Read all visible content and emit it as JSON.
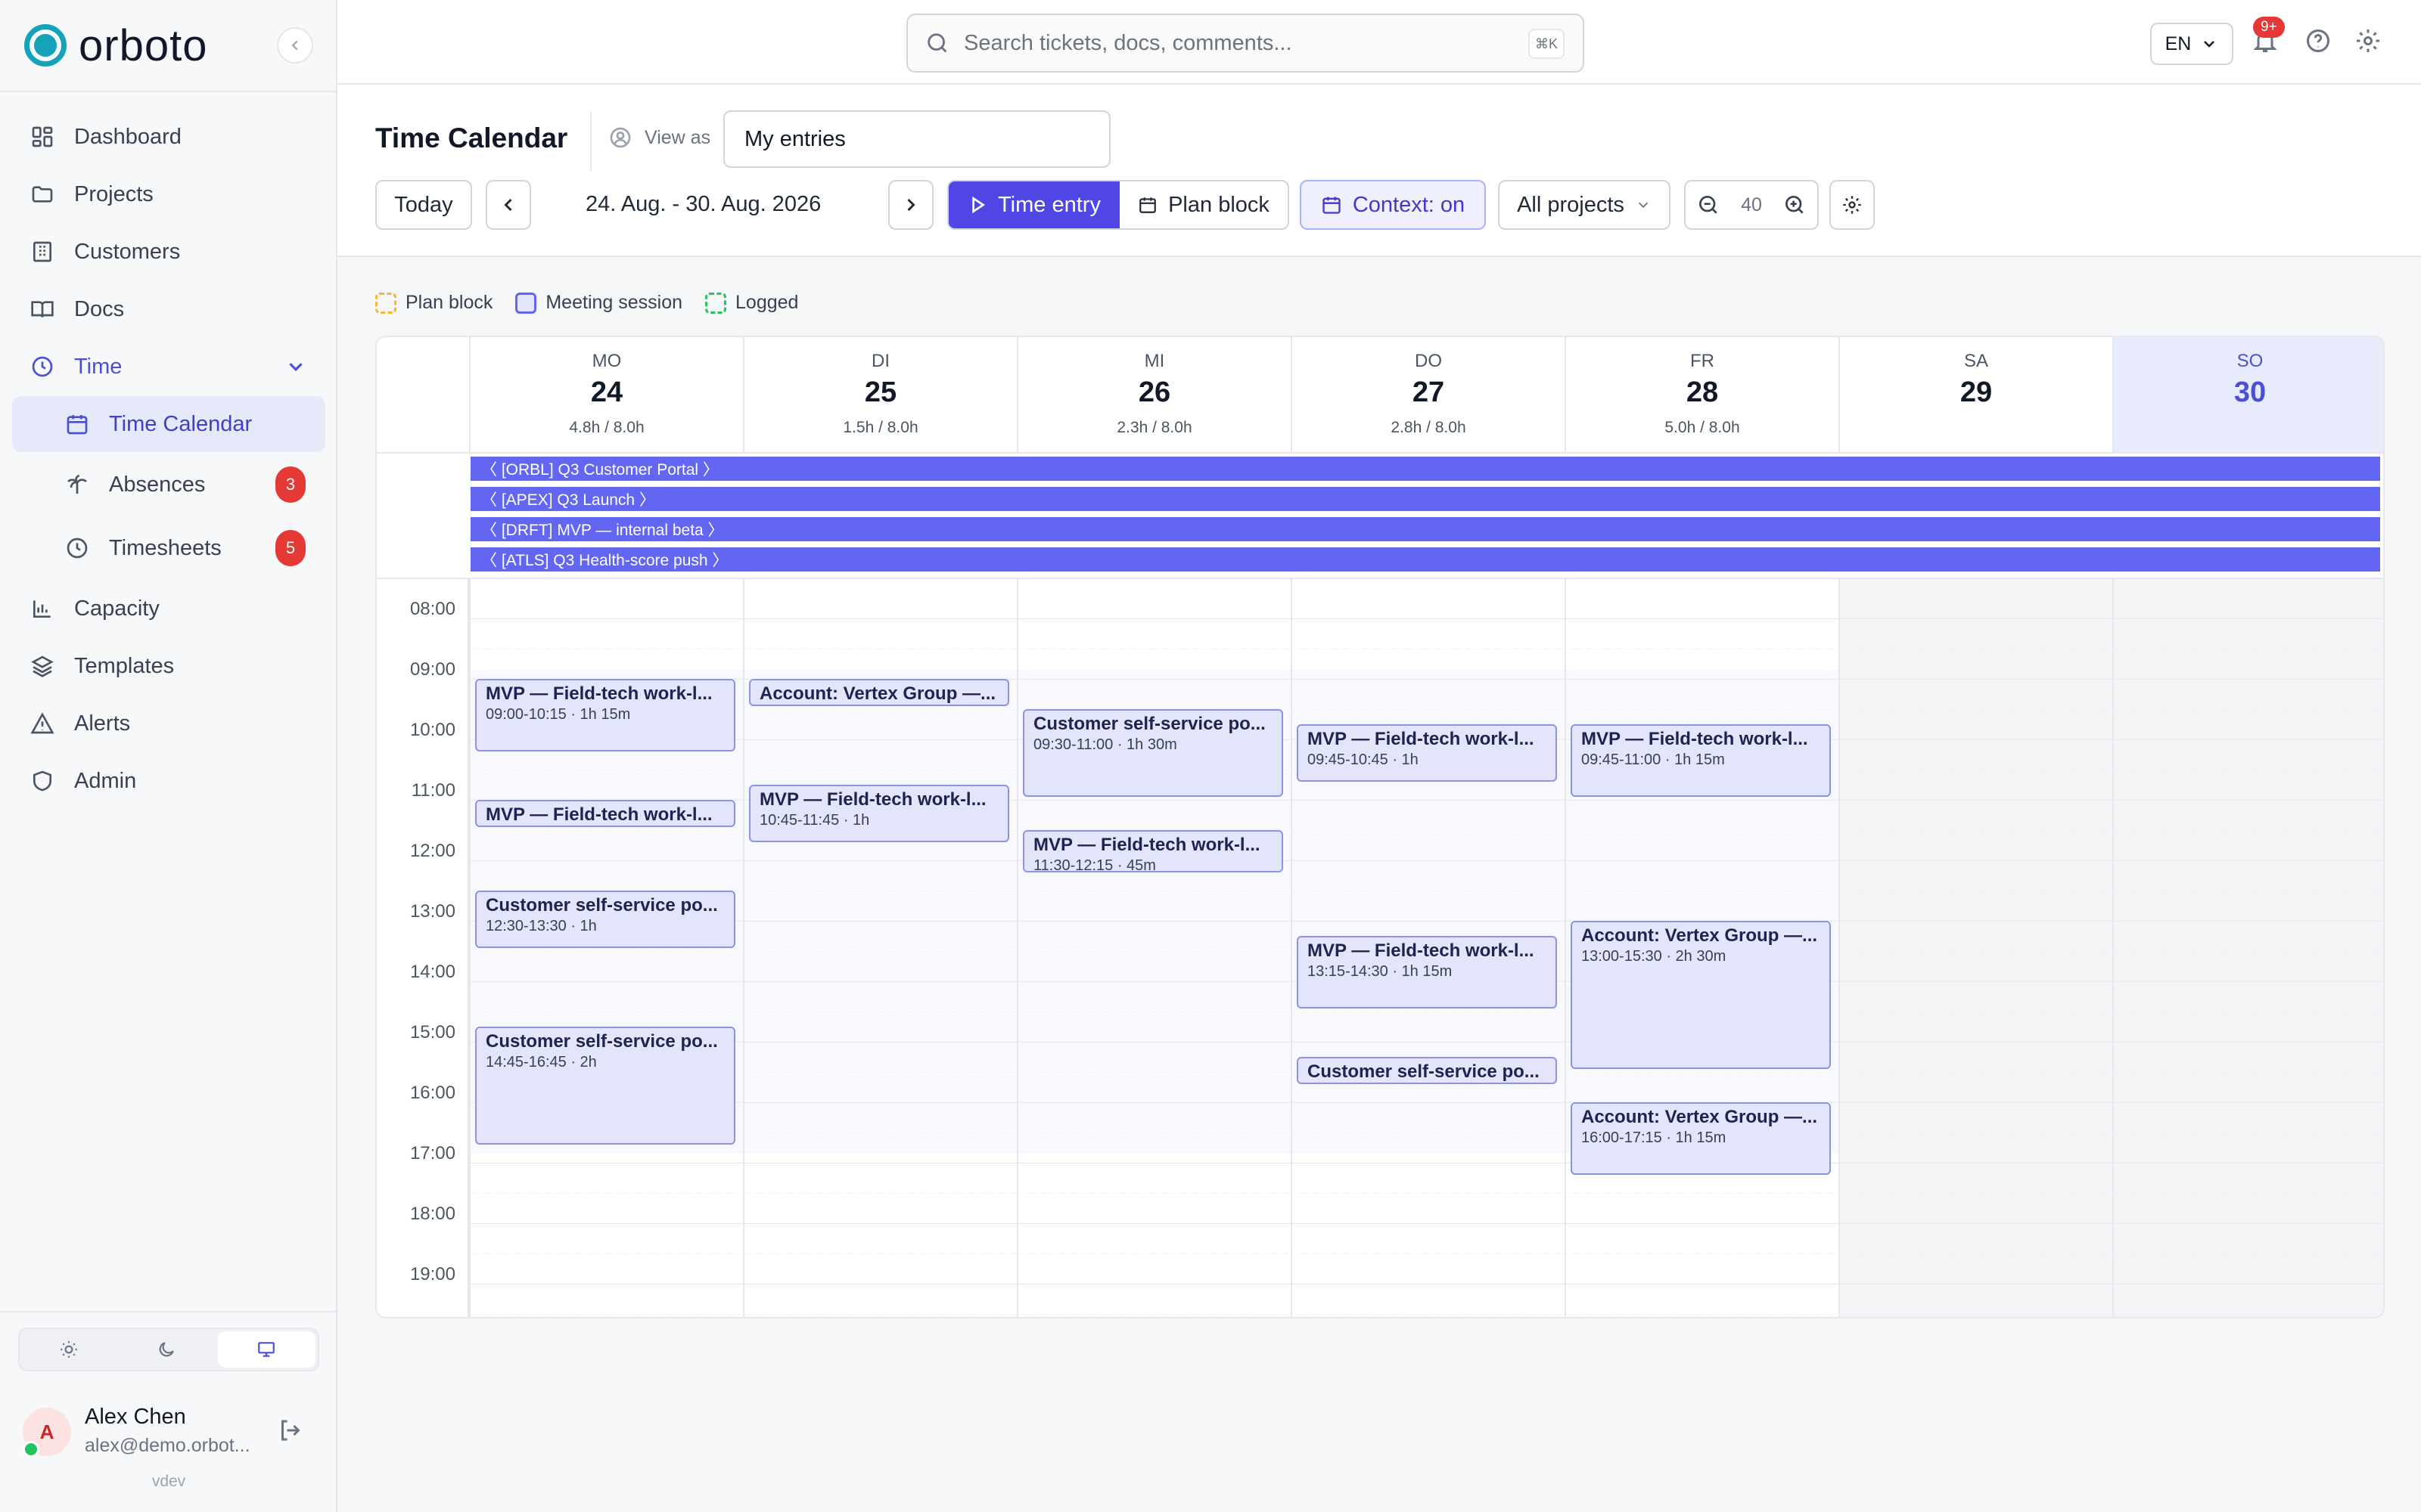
{
  "app": {
    "name": "orboto",
    "version": "vdev"
  },
  "sidebar": {
    "items": [
      {
        "label": "Dashboard",
        "icon": "dashboard-icon"
      },
      {
        "label": "Projects",
        "icon": "folder-icon"
      },
      {
        "label": "Customers",
        "icon": "building-icon"
      },
      {
        "label": "Docs",
        "icon": "book-icon"
      },
      {
        "label": "Time",
        "icon": "clock-icon"
      },
      {
        "label": "Time Calendar",
        "icon": "calendar-icon"
      },
      {
        "label": "Absences",
        "icon": "palm-tree-icon",
        "badge": "3"
      },
      {
        "label": "Timesheets",
        "icon": "clock-icon",
        "badge": "5"
      },
      {
        "label": "Capacity",
        "icon": "bar-chart-icon"
      },
      {
        "label": "Templates",
        "icon": "layers-icon"
      },
      {
        "label": "Alerts",
        "icon": "alert-triangle-icon"
      },
      {
        "label": "Admin",
        "icon": "shield-icon"
      }
    ],
    "theme": [
      "light",
      "dark",
      "system"
    ]
  },
  "user": {
    "initial": "A",
    "name": "Alex Chen",
    "email": "alex@demo.orbot..."
  },
  "topbar": {
    "search_placeholder": "Search tickets, docs, comments...",
    "shortcut": "⌘K",
    "language": "EN",
    "notifications_badge": "9+"
  },
  "header": {
    "title": "Time Calendar",
    "view_as_label": "View as",
    "view_as_value": "My entries",
    "today_label": "Today",
    "date_range": "24. Aug. - 30. Aug. 2026",
    "time_entry_label": "Time entry",
    "plan_block_label": "Plan block",
    "context_label": "Context: on",
    "projects_filter": "All projects",
    "zoom_value": "40"
  },
  "legend": [
    {
      "label": "Plan block",
      "color": "#f5b82e"
    },
    {
      "label": "Meeting session",
      "color": "#6366f1"
    },
    {
      "label": "Logged",
      "color": "#22c55e"
    }
  ],
  "calendar": {
    "days": [
      {
        "name": "MO",
        "num": "24",
        "hours": "4.8h / 8.0h"
      },
      {
        "name": "DI",
        "num": "25",
        "hours": "1.5h / 8.0h"
      },
      {
        "name": "MI",
        "num": "26",
        "hours": "2.3h / 8.0h"
      },
      {
        "name": "DO",
        "num": "27",
        "hours": "2.8h / 8.0h"
      },
      {
        "name": "FR",
        "num": "28",
        "hours": "5.0h / 8.0h"
      },
      {
        "name": "SA",
        "num": "29",
        "hours": ""
      },
      {
        "name": "SO",
        "num": "30",
        "hours": ""
      }
    ],
    "allday": [
      "〈 [ORBL] Q3 Customer Portal 〉",
      "〈 [APEX] Q3 Launch 〉",
      "〈 [DRFT] MVP — internal beta 〉",
      "〈 [ATLS] Q3 Health-score push 〉"
    ],
    "hours": [
      "08:00",
      "09:00",
      "10:00",
      "11:00",
      "12:00",
      "13:00",
      "14:00",
      "15:00",
      "16:00",
      "17:00",
      "18:00",
      "19:00"
    ],
    "events": [
      {
        "day": 0,
        "start": "09:00",
        "end": "10:15",
        "title": "MVP — Field-tech work-l...",
        "sub": "09:00-10:15 · 1h 15m"
      },
      {
        "day": 0,
        "start": "11:00",
        "end": "11:30",
        "title": "MVP — Field-tech work-l...",
        "sub": ""
      },
      {
        "day": 0,
        "start": "12:30",
        "end": "13:30",
        "title": "Customer self-service po...",
        "sub": "12:30-13:30 · 1h"
      },
      {
        "day": 0,
        "start": "14:45",
        "end": "16:45",
        "title": "Customer self-service po...",
        "sub": "14:45-16:45 · 2h"
      },
      {
        "day": 1,
        "start": "09:00",
        "end": "09:30",
        "title": "Account: Vertex Group —...",
        "sub": ""
      },
      {
        "day": 1,
        "start": "10:45",
        "end": "11:45",
        "title": "MVP — Field-tech work-l...",
        "sub": "10:45-11:45 · 1h"
      },
      {
        "day": 2,
        "start": "09:30",
        "end": "11:00",
        "title": "Customer self-service po...",
        "sub": "09:30-11:00 · 1h 30m"
      },
      {
        "day": 2,
        "start": "11:30",
        "end": "12:15",
        "title": "MVP — Field-tech work-l...",
        "sub": "11:30-12:15 · 45m"
      },
      {
        "day": 3,
        "start": "09:45",
        "end": "10:45",
        "title": "MVP — Field-tech work-l...",
        "sub": "09:45-10:45 · 1h"
      },
      {
        "day": 3,
        "start": "13:15",
        "end": "14:30",
        "title": "MVP — Field-tech work-l...",
        "sub": "13:15-14:30 · 1h 15m"
      },
      {
        "day": 3,
        "start": "15:15",
        "end": "15:45",
        "title": "Customer self-service po...",
        "sub": ""
      },
      {
        "day": 4,
        "start": "09:45",
        "end": "11:00",
        "title": "MVP — Field-tech work-l...",
        "sub": "09:45-11:00 · 1h 15m"
      },
      {
        "day": 4,
        "start": "13:00",
        "end": "15:30",
        "title": "Account: Vertex Group —...",
        "sub": "13:00-15:30 · 2h 30m"
      },
      {
        "day": 4,
        "start": "16:00",
        "end": "17:15",
        "title": "Account: Vertex Group —...",
        "sub": "16:00-17:15 · 1h 15m"
      }
    ]
  }
}
